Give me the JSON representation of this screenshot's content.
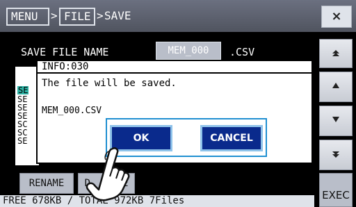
{
  "breadcrumb": {
    "menu": "MENU",
    "sep1": ">",
    "file": "FILE",
    "sep2": ">",
    "save": "SAVE"
  },
  "close_label": "×",
  "save_file_name_label": "SAVE FILE NAME",
  "file_name_value": "MEM_000",
  "file_ext": ".CSV",
  "background_list": [
    "SE",
    "SE",
    "SE",
    "SE",
    "SC",
    "SC",
    "SE"
  ],
  "dialog": {
    "title": "INFO:030",
    "message": "The file will be saved.",
    "file": "MEM_000.CSV",
    "ok": "OK",
    "cancel": "CANCEL"
  },
  "bottom": {
    "rename": "RENAME",
    "delete_partial_left": "D",
    "delete_partial_right": "E",
    "exec": "EXEC"
  },
  "status": "FREE 678KB / TOTAL 972KB 7Files",
  "side_icons": [
    "double-up-arrow-icon",
    "up-arrow-icon",
    "down-arrow-icon",
    "double-down-arrow-icon"
  ],
  "colors": {
    "topbar": "#595e6e",
    "dialog_button": "#0a2a8c",
    "dialog_frame": "#1f8fd1",
    "highlight": "#2fb6a8"
  }
}
